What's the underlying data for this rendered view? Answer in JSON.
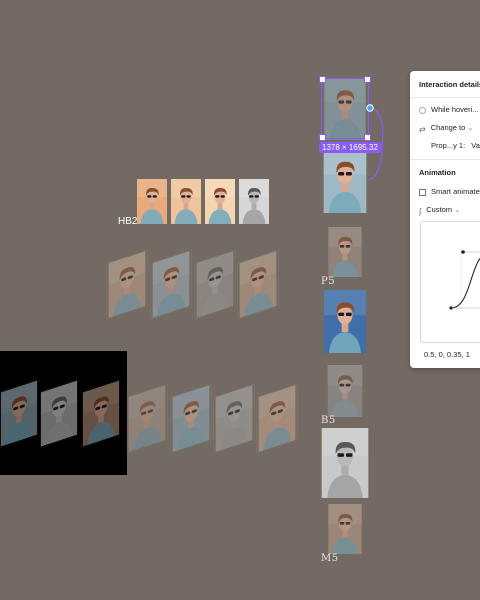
{
  "canvas": {
    "background": "#736a63",
    "labels": {
      "hb2": "HB2",
      "p5": "P5",
      "b5": "B5",
      "m5": "M5"
    },
    "selection_dimensions": "1378 × 1695.32",
    "selection_color": "#8a5cf6"
  },
  "panel": {
    "interaction_title": "Interaction details",
    "trigger_label": "While hoveri...",
    "action_label": "Change to",
    "property_label": "Prop...y 1:",
    "property_value": "Vari",
    "animation_title": "Animation",
    "animation_type": "Smart animate",
    "easing_label": "Custom",
    "bezier_values": "0.5, 0, 0.35, 1"
  }
}
